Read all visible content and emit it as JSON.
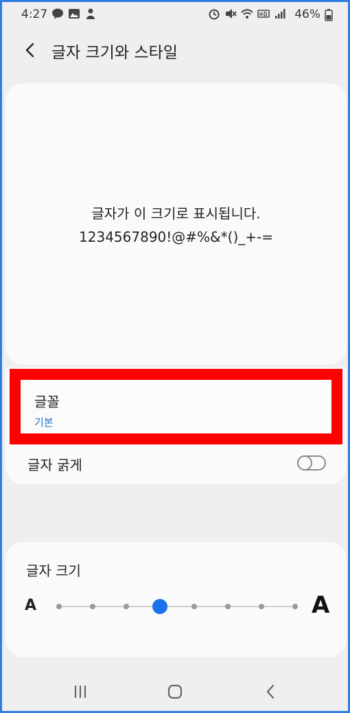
{
  "status_bar": {
    "time": "4:27",
    "battery": "46%",
    "icons": [
      "talk-icon",
      "image-icon",
      "person-icon",
      "alarm-icon",
      "mute-icon",
      "wifi-icon",
      "hd-icon",
      "signal-icon",
      "battery-icon"
    ]
  },
  "header": {
    "title": "글자 크기와 스타일"
  },
  "preview": {
    "line1": "글자가 이 크기로 표시됩니다.",
    "line2": "1234567890!@#%&*()_+-="
  },
  "font_setting": {
    "label": "글꼴",
    "value": "기본"
  },
  "bold_setting": {
    "label": "글자 굵게",
    "enabled": false
  },
  "font_size": {
    "label": "글자 크기",
    "small_glyph": "A",
    "large_glyph": "A",
    "steps": 8,
    "selected_index": 3
  },
  "colors": {
    "accent": "#1a73e8",
    "highlight_border": "#ff0000",
    "link": "#1a73c8"
  },
  "nav_bar": {
    "icons": [
      "recents-icon",
      "home-icon",
      "back-icon"
    ]
  }
}
